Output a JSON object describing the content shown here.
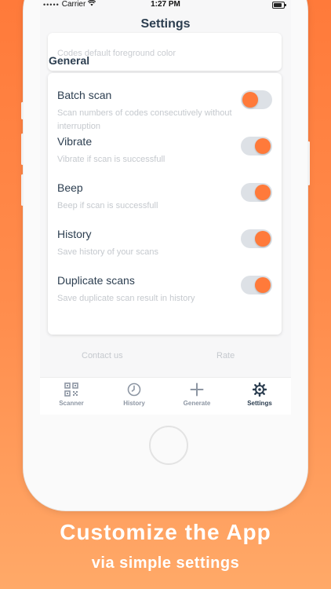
{
  "status_bar": {
    "carrier": "Carrier",
    "time": "1:27 PM",
    "signal_icon": "dots-signal-icon",
    "wifi_icon": "wifi-icon",
    "battery_icon": "battery-icon"
  },
  "nav": {
    "title": "Settings"
  },
  "top_card": {
    "subtitle": "Codes default foreground color"
  },
  "section": {
    "title": "General"
  },
  "settings": [
    {
      "title": "Batch scan",
      "description": "Scan numbers of codes consecutively without interruption",
      "enabled": false
    },
    {
      "title": "Vibrate",
      "description": "Vibrate if scan is successfull",
      "enabled": true
    },
    {
      "title": "Beep",
      "description": "Beep if scan is successfull",
      "enabled": true
    },
    {
      "title": "History",
      "description": "Save history of your scans",
      "enabled": true
    },
    {
      "title": "Duplicate scans",
      "description": "Save duplicate scan result in history",
      "enabled": true
    }
  ],
  "links": {
    "contact": "Contact us",
    "rate": "Rate"
  },
  "tabs": [
    {
      "label": "Scanner",
      "icon": "qr-code-icon",
      "active": false
    },
    {
      "label": "History",
      "icon": "clock-icon",
      "active": false
    },
    {
      "label": "Generate",
      "icon": "plus-icon",
      "active": false
    },
    {
      "label": "Settings",
      "icon": "gear-icon",
      "active": true
    }
  ],
  "caption": {
    "line1": "Customize the App",
    "line2": "via simple settings"
  },
  "colors": {
    "accent": "#ff7a3a",
    "text_dark": "#2c3e50",
    "text_muted": "#c5c9ce",
    "toggle_track": "#dde1e6"
  }
}
